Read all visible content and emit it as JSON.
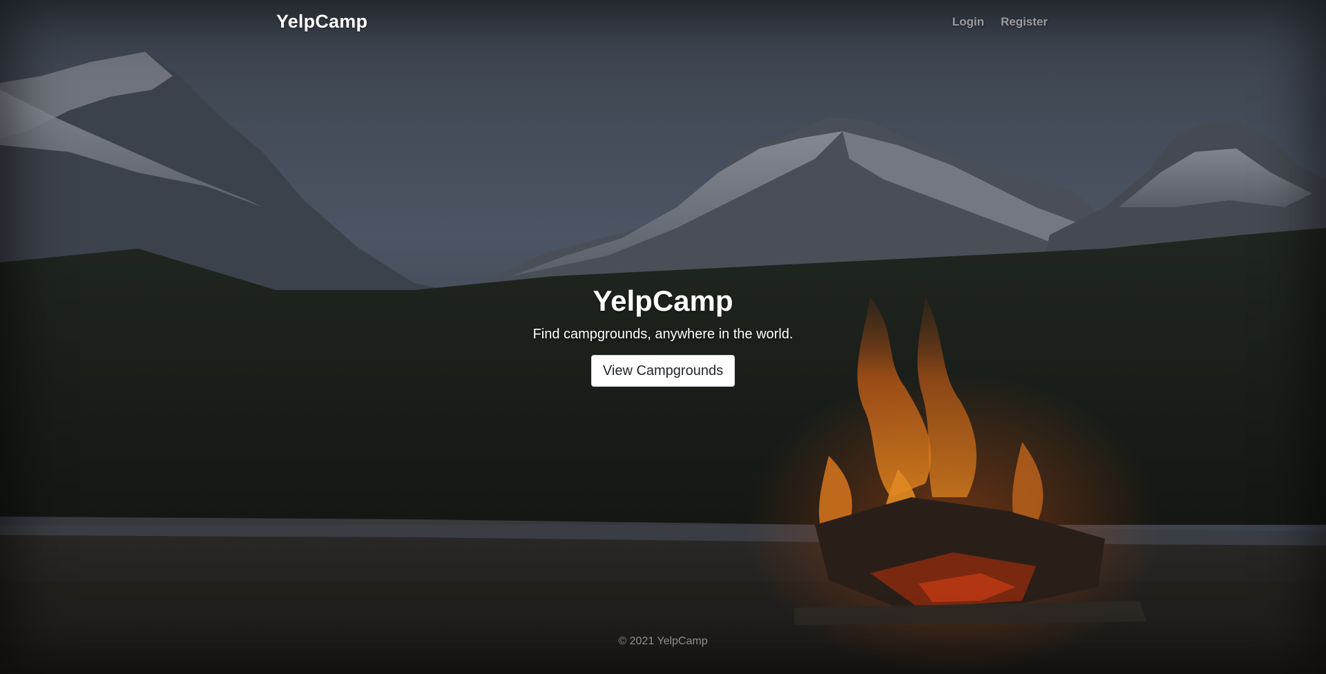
{
  "navbar": {
    "brand": "YelpCamp",
    "links": [
      {
        "label": "Login"
      },
      {
        "label": "Register"
      }
    ]
  },
  "hero": {
    "title": "YelpCamp",
    "subtitle": "Find campgrounds, anywhere in the world.",
    "button_label": "View Campgrounds"
  },
  "footer": {
    "text": "© 2021 YelpCamp"
  },
  "colors": {
    "sky": "#4a5360",
    "forest": "#1a1e1a",
    "fire": "#e0771e",
    "button_bg": "#ffffff"
  },
  "background": {
    "icon": "mountain-campfire-photo"
  }
}
